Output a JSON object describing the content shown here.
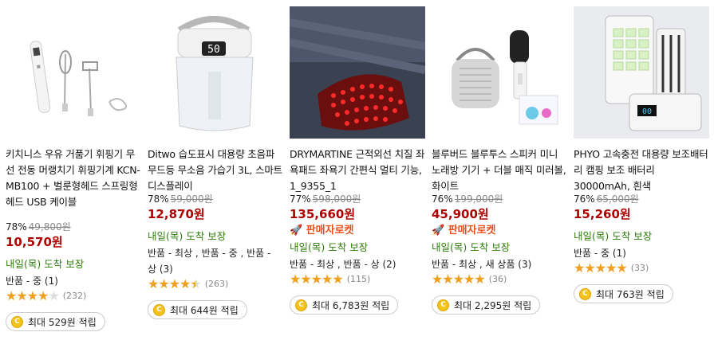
{
  "products": [
    {
      "title": "키치니스 우유 거품기 휘핑기 무선 전동 머랭치기 휘핑기계 KCN-MB100 + 벌룬형헤드 스프링형헤드 USB 케이블",
      "discount": "78%",
      "original_price": "49,800원",
      "price": "10,570원",
      "delivery": "내일(목) 도착 보장",
      "returns": "반품 - 중 (1)",
      "rating": 4.0,
      "review_count": "(232)",
      "reward": "최대 529원 적립"
    },
    {
      "title": "Ditwo 습도표시 대용량 초음파 무드등 무소음 가습기 3L, 스마트 디스플레이",
      "discount": "78%",
      "original_price": "59,000원",
      "price": "12,870원",
      "delivery": "내일(목) 도착 보장",
      "returns": "반품 - 최상 , 반품 - 중 , 반품 - 상 (3)",
      "rating": 4.5,
      "review_count": "(263)",
      "reward": "최대 644원 적립",
      "display_number": "50"
    },
    {
      "title": "DRYMARTINE 근적외선 치질 좌욕패드 좌욕기 간편식 멀티 기능, 1_9355_1",
      "discount": "77%",
      "original_price": "598,000원",
      "price": "135,660원",
      "badge": "판매자로켓",
      "delivery": "내일(목) 도착 보장",
      "returns": "반품 - 최상 , 반품 - 상 (2)",
      "rating": 5.0,
      "review_count": "(115)",
      "reward": "최대 6,783원 적립"
    },
    {
      "title": "블루버드 블루투스 스피커 미니 노래방 기기 + 더블 매직 미러볼, 화이트",
      "discount": "76%",
      "original_price": "199,000원",
      "price": "45,900원",
      "badge": "판매자로켓",
      "delivery": "내일(목) 도착 보장",
      "returns": "반품 - 최상 , 새 상품 (3)",
      "rating": 5.0,
      "review_count": "(36)",
      "reward": "최대 2,295원 적립"
    },
    {
      "title": "PHYO 고속충전 대용량 보조배터리 캠핑 보조 배터리 30000mAh, 흰색",
      "discount": "76%",
      "original_price": "65,000원",
      "price": "15,260원",
      "delivery": "내일(목) 도착 보장",
      "returns": "반품 - 중 (1)",
      "rating": 5.0,
      "review_count": "(33)",
      "reward": "최대 763원 적립"
    }
  ],
  "colors": {
    "price": "#ae0000",
    "delivery": "#2f7d0c",
    "rocket": "#e94e1b",
    "star": "#f0a01e",
    "coin": "#f4c21b"
  },
  "icons": {
    "rocket": "rocket-icon",
    "coin": "coin-icon",
    "star": "star-icon"
  }
}
